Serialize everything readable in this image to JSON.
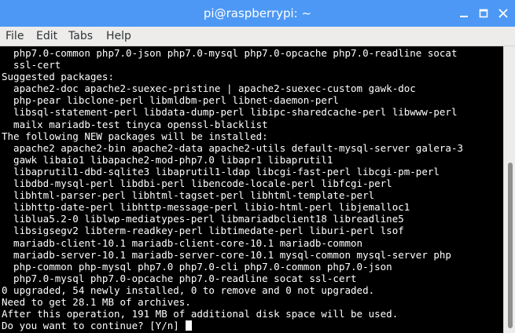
{
  "window": {
    "title": "pi@raspberrypi: ~",
    "controls": {
      "minimize_icon": "minimize-icon",
      "maximize_icon": "maximize-icon",
      "close_icon": "close-icon"
    },
    "titlebar_color": "#4d98f5"
  },
  "menubar": {
    "items": [
      {
        "label": "File"
      },
      {
        "label": "Edit"
      },
      {
        "label": "Tabs"
      },
      {
        "label": "Help"
      }
    ]
  },
  "terminal": {
    "background": "#000000",
    "foreground": "#ffffff",
    "lines": [
      "  php7.0-common php7.0-json php7.0-mysql php7.0-opcache php7.0-readline socat",
      "  ssl-cert",
      "Suggested packages:",
      "  apache2-doc apache2-suexec-pristine | apache2-suexec-custom gawk-doc",
      "  php-pear libclone-perl libmldbm-perl libnet-daemon-perl",
      "  libsql-statement-perl libdata-dump-perl libipc-sharedcache-perl libwww-perl",
      "  mailx mariadb-test tinyca openssl-blacklist",
      "The following NEW packages will be installed:",
      "  apache2 apache2-bin apache2-data apache2-utils default-mysql-server galera-3",
      "  gawk libaio1 libapache2-mod-php7.0 libapr1 libaprutil1",
      "  libaprutil1-dbd-sqlite3 libaprutil1-ldap libcgi-fast-perl libcgi-pm-perl",
      "  libdbd-mysql-perl libdbi-perl libencode-locale-perl libfcgi-perl",
      "  libhtml-parser-perl libhtml-tagset-perl libhtml-template-perl",
      "  libhttp-date-perl libhttp-message-perl libio-html-perl libjemalloc1",
      "  liblua5.2-0 liblwp-mediatypes-perl libmariadbclient18 libreadline5",
      "  libsigsegv2 libterm-readkey-perl libtimedate-perl liburi-perl lsof",
      "  mariadb-client-10.1 mariadb-client-core-10.1 mariadb-common",
      "  mariadb-server-10.1 mariadb-server-core-10.1 mysql-common mysql-server php",
      "  php-common php-mysql php7.0 php7.0-cli php7.0-common php7.0-json",
      "  php7.0-mysql php7.0-opcache php7.0-readline socat ssl-cert",
      "0 upgraded, 54 newly installed, 0 to remove and 0 not upgraded.",
      "Need to get 28.1 MB of archives.",
      "After this operation, 191 MB of additional disk space will be used.",
      "Do you want to continue? [Y/n] "
    ]
  }
}
